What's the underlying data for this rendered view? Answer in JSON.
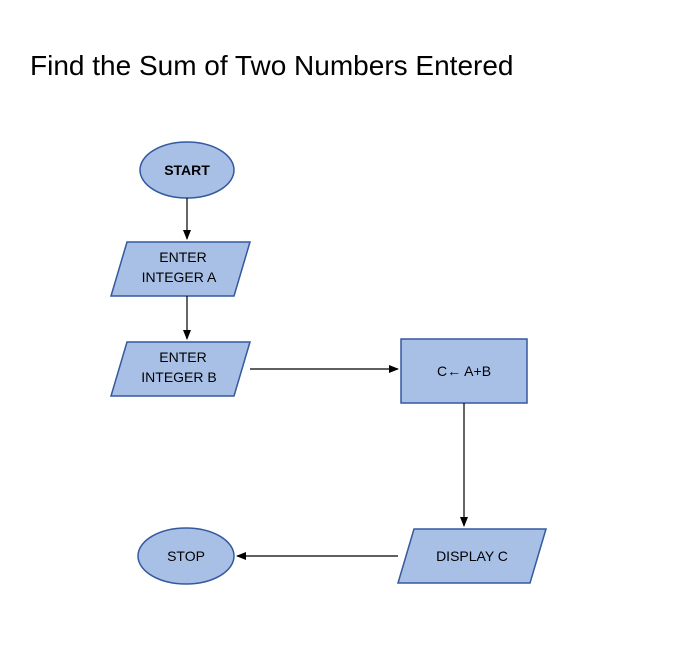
{
  "title": "Find the Sum of Two Numbers Entered",
  "colors": {
    "fill": "#a9c0e6",
    "stroke": "#34599f",
    "arrow": "#000000"
  },
  "nodes": {
    "start": "START",
    "enterA_line1": "ENTER",
    "enterA_line2": "INTEGER A",
    "enterB_line1": "ENTER",
    "enterB_line2": "INTEGER B",
    "process": "C← A+B",
    "display": "DISPLAY C",
    "stop": "STOP"
  }
}
